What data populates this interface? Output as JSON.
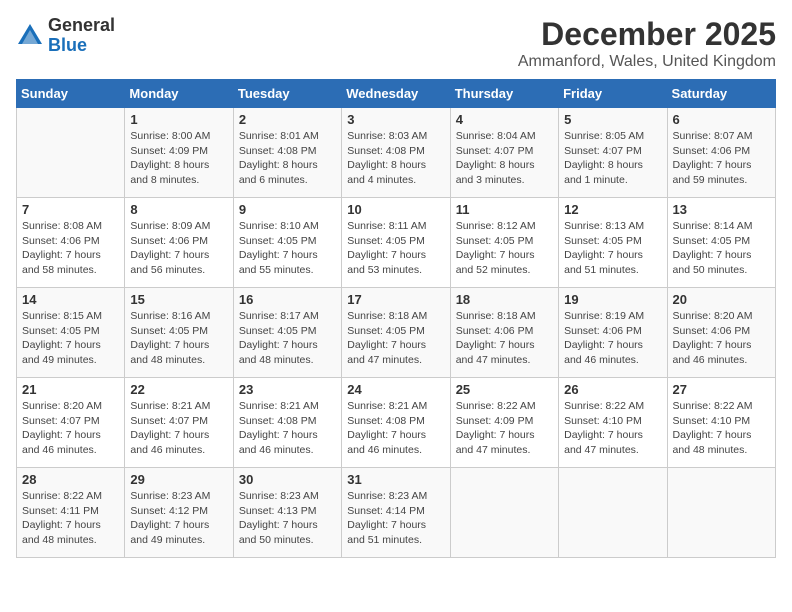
{
  "header": {
    "logo_line1": "General",
    "logo_line2": "Blue",
    "month": "December 2025",
    "location": "Ammanford, Wales, United Kingdom"
  },
  "weekdays": [
    "Sunday",
    "Monday",
    "Tuesday",
    "Wednesday",
    "Thursday",
    "Friday",
    "Saturday"
  ],
  "weeks": [
    [
      {
        "day": "",
        "info": ""
      },
      {
        "day": "1",
        "info": "Sunrise: 8:00 AM\nSunset: 4:09 PM\nDaylight: 8 hours\nand 8 minutes."
      },
      {
        "day": "2",
        "info": "Sunrise: 8:01 AM\nSunset: 4:08 PM\nDaylight: 8 hours\nand 6 minutes."
      },
      {
        "day": "3",
        "info": "Sunrise: 8:03 AM\nSunset: 4:08 PM\nDaylight: 8 hours\nand 4 minutes."
      },
      {
        "day": "4",
        "info": "Sunrise: 8:04 AM\nSunset: 4:07 PM\nDaylight: 8 hours\nand 3 minutes."
      },
      {
        "day": "5",
        "info": "Sunrise: 8:05 AM\nSunset: 4:07 PM\nDaylight: 8 hours\nand 1 minute."
      },
      {
        "day": "6",
        "info": "Sunrise: 8:07 AM\nSunset: 4:06 PM\nDaylight: 7 hours\nand 59 minutes."
      }
    ],
    [
      {
        "day": "7",
        "info": "Sunrise: 8:08 AM\nSunset: 4:06 PM\nDaylight: 7 hours\nand 58 minutes."
      },
      {
        "day": "8",
        "info": "Sunrise: 8:09 AM\nSunset: 4:06 PM\nDaylight: 7 hours\nand 56 minutes."
      },
      {
        "day": "9",
        "info": "Sunrise: 8:10 AM\nSunset: 4:05 PM\nDaylight: 7 hours\nand 55 minutes."
      },
      {
        "day": "10",
        "info": "Sunrise: 8:11 AM\nSunset: 4:05 PM\nDaylight: 7 hours\nand 53 minutes."
      },
      {
        "day": "11",
        "info": "Sunrise: 8:12 AM\nSunset: 4:05 PM\nDaylight: 7 hours\nand 52 minutes."
      },
      {
        "day": "12",
        "info": "Sunrise: 8:13 AM\nSunset: 4:05 PM\nDaylight: 7 hours\nand 51 minutes."
      },
      {
        "day": "13",
        "info": "Sunrise: 8:14 AM\nSunset: 4:05 PM\nDaylight: 7 hours\nand 50 minutes."
      }
    ],
    [
      {
        "day": "14",
        "info": "Sunrise: 8:15 AM\nSunset: 4:05 PM\nDaylight: 7 hours\nand 49 minutes."
      },
      {
        "day": "15",
        "info": "Sunrise: 8:16 AM\nSunset: 4:05 PM\nDaylight: 7 hours\nand 48 minutes."
      },
      {
        "day": "16",
        "info": "Sunrise: 8:17 AM\nSunset: 4:05 PM\nDaylight: 7 hours\nand 48 minutes."
      },
      {
        "day": "17",
        "info": "Sunrise: 8:18 AM\nSunset: 4:05 PM\nDaylight: 7 hours\nand 47 minutes."
      },
      {
        "day": "18",
        "info": "Sunrise: 8:18 AM\nSunset: 4:06 PM\nDaylight: 7 hours\nand 47 minutes."
      },
      {
        "day": "19",
        "info": "Sunrise: 8:19 AM\nSunset: 4:06 PM\nDaylight: 7 hours\nand 46 minutes."
      },
      {
        "day": "20",
        "info": "Sunrise: 8:20 AM\nSunset: 4:06 PM\nDaylight: 7 hours\nand 46 minutes."
      }
    ],
    [
      {
        "day": "21",
        "info": "Sunrise: 8:20 AM\nSunset: 4:07 PM\nDaylight: 7 hours\nand 46 minutes."
      },
      {
        "day": "22",
        "info": "Sunrise: 8:21 AM\nSunset: 4:07 PM\nDaylight: 7 hours\nand 46 minutes."
      },
      {
        "day": "23",
        "info": "Sunrise: 8:21 AM\nSunset: 4:08 PM\nDaylight: 7 hours\nand 46 minutes."
      },
      {
        "day": "24",
        "info": "Sunrise: 8:21 AM\nSunset: 4:08 PM\nDaylight: 7 hours\nand 46 minutes."
      },
      {
        "day": "25",
        "info": "Sunrise: 8:22 AM\nSunset: 4:09 PM\nDaylight: 7 hours\nand 47 minutes."
      },
      {
        "day": "26",
        "info": "Sunrise: 8:22 AM\nSunset: 4:10 PM\nDaylight: 7 hours\nand 47 minutes."
      },
      {
        "day": "27",
        "info": "Sunrise: 8:22 AM\nSunset: 4:10 PM\nDaylight: 7 hours\nand 48 minutes."
      }
    ],
    [
      {
        "day": "28",
        "info": "Sunrise: 8:22 AM\nSunset: 4:11 PM\nDaylight: 7 hours\nand 48 minutes."
      },
      {
        "day": "29",
        "info": "Sunrise: 8:23 AM\nSunset: 4:12 PM\nDaylight: 7 hours\nand 49 minutes."
      },
      {
        "day": "30",
        "info": "Sunrise: 8:23 AM\nSunset: 4:13 PM\nDaylight: 7 hours\nand 50 minutes."
      },
      {
        "day": "31",
        "info": "Sunrise: 8:23 AM\nSunset: 4:14 PM\nDaylight: 7 hours\nand 51 minutes."
      },
      {
        "day": "",
        "info": ""
      },
      {
        "day": "",
        "info": ""
      },
      {
        "day": "",
        "info": ""
      }
    ]
  ]
}
